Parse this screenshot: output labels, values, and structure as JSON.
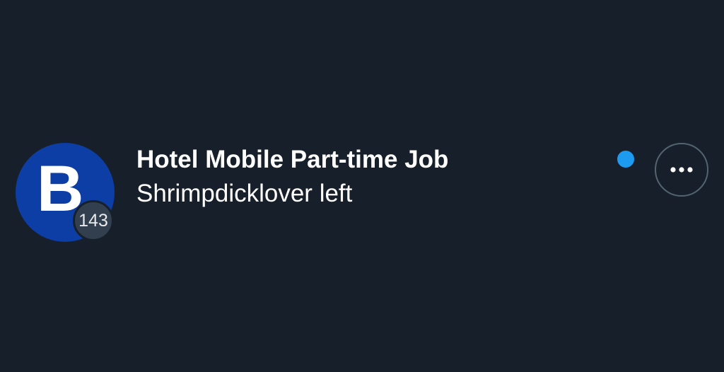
{
  "conversation": {
    "avatar_letter": "B",
    "avatar_color": "#0d3ea6",
    "member_count": "143",
    "title": "Hotel Mobile Part-time Job",
    "preview": "Shrimpdicklover left",
    "unread_indicator_color": "#1d9bf0",
    "more_icon": "more-horizontal-icon"
  },
  "colors": {
    "background": "#17202a",
    "text": "#ffffff",
    "badge_background": "#323f4e",
    "button_border": "#536471"
  }
}
